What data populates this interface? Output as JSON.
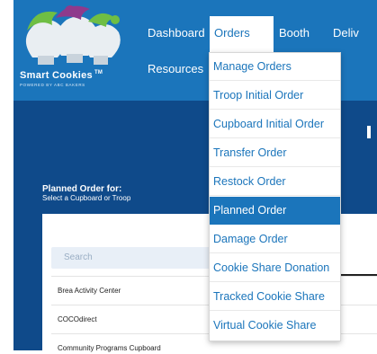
{
  "brand": {
    "logo_text": "Smart Cookies",
    "logo_tm": "TM",
    "logo_sub": "POWERED BY ABC BAKERS"
  },
  "colors": {
    "header_blue": "#1B75BB",
    "dark_blue": "#0F4A8A",
    "active_item": "#1B75BB",
    "link_blue": "#1B75BB"
  },
  "nav": {
    "dashboard": "Dashboard",
    "orders": "Orders",
    "booth": "Booth",
    "delivery": "Deliv",
    "resources": "Resources"
  },
  "orders_menu": {
    "items": [
      "Manage Orders",
      "Troop Initial Order",
      "Cupboard Initial Order",
      "Transfer Order",
      "Restock Order",
      "Planned Order",
      "Damage Order",
      "Cookie Share Donation",
      "Tracked Cookie Share",
      "Virtual Cookie Share"
    ],
    "selected": "Planned Order"
  },
  "page": {
    "title": "Planned Order for:",
    "subtitle": "Select a Cupboard or Troop"
  },
  "search": {
    "placeholder": "Search"
  },
  "locations": [
    "Brea Activity Center",
    "COCOdirect",
    "Community Programs Cupboard"
  ]
}
